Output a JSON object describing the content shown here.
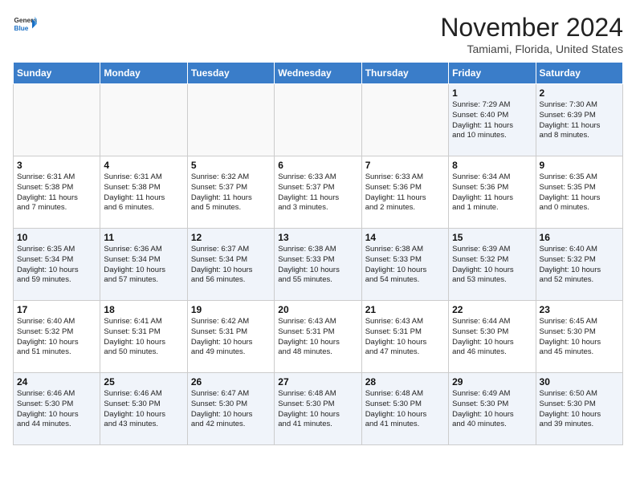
{
  "header": {
    "logo_line1": "General",
    "logo_line2": "Blue",
    "month_title": "November 2024",
    "location": "Tamiami, Florida, United States"
  },
  "weekdays": [
    "Sunday",
    "Monday",
    "Tuesday",
    "Wednesday",
    "Thursday",
    "Friday",
    "Saturday"
  ],
  "weeks": [
    [
      {
        "day": "",
        "detail": ""
      },
      {
        "day": "",
        "detail": ""
      },
      {
        "day": "",
        "detail": ""
      },
      {
        "day": "",
        "detail": ""
      },
      {
        "day": "",
        "detail": ""
      },
      {
        "day": "1",
        "detail": "Sunrise: 7:29 AM\nSunset: 6:40 PM\nDaylight: 11 hours\nand 10 minutes."
      },
      {
        "day": "2",
        "detail": "Sunrise: 7:30 AM\nSunset: 6:39 PM\nDaylight: 11 hours\nand 8 minutes."
      }
    ],
    [
      {
        "day": "3",
        "detail": "Sunrise: 6:31 AM\nSunset: 5:38 PM\nDaylight: 11 hours\nand 7 minutes."
      },
      {
        "day": "4",
        "detail": "Sunrise: 6:31 AM\nSunset: 5:38 PM\nDaylight: 11 hours\nand 6 minutes."
      },
      {
        "day": "5",
        "detail": "Sunrise: 6:32 AM\nSunset: 5:37 PM\nDaylight: 11 hours\nand 5 minutes."
      },
      {
        "day": "6",
        "detail": "Sunrise: 6:33 AM\nSunset: 5:37 PM\nDaylight: 11 hours\nand 3 minutes."
      },
      {
        "day": "7",
        "detail": "Sunrise: 6:33 AM\nSunset: 5:36 PM\nDaylight: 11 hours\nand 2 minutes."
      },
      {
        "day": "8",
        "detail": "Sunrise: 6:34 AM\nSunset: 5:36 PM\nDaylight: 11 hours\nand 1 minute."
      },
      {
        "day": "9",
        "detail": "Sunrise: 6:35 AM\nSunset: 5:35 PM\nDaylight: 11 hours\nand 0 minutes."
      }
    ],
    [
      {
        "day": "10",
        "detail": "Sunrise: 6:35 AM\nSunset: 5:34 PM\nDaylight: 10 hours\nand 59 minutes."
      },
      {
        "day": "11",
        "detail": "Sunrise: 6:36 AM\nSunset: 5:34 PM\nDaylight: 10 hours\nand 57 minutes."
      },
      {
        "day": "12",
        "detail": "Sunrise: 6:37 AM\nSunset: 5:34 PM\nDaylight: 10 hours\nand 56 minutes."
      },
      {
        "day": "13",
        "detail": "Sunrise: 6:38 AM\nSunset: 5:33 PM\nDaylight: 10 hours\nand 55 minutes."
      },
      {
        "day": "14",
        "detail": "Sunrise: 6:38 AM\nSunset: 5:33 PM\nDaylight: 10 hours\nand 54 minutes."
      },
      {
        "day": "15",
        "detail": "Sunrise: 6:39 AM\nSunset: 5:32 PM\nDaylight: 10 hours\nand 53 minutes."
      },
      {
        "day": "16",
        "detail": "Sunrise: 6:40 AM\nSunset: 5:32 PM\nDaylight: 10 hours\nand 52 minutes."
      }
    ],
    [
      {
        "day": "17",
        "detail": "Sunrise: 6:40 AM\nSunset: 5:32 PM\nDaylight: 10 hours\nand 51 minutes."
      },
      {
        "day": "18",
        "detail": "Sunrise: 6:41 AM\nSunset: 5:31 PM\nDaylight: 10 hours\nand 50 minutes."
      },
      {
        "day": "19",
        "detail": "Sunrise: 6:42 AM\nSunset: 5:31 PM\nDaylight: 10 hours\nand 49 minutes."
      },
      {
        "day": "20",
        "detail": "Sunrise: 6:43 AM\nSunset: 5:31 PM\nDaylight: 10 hours\nand 48 minutes."
      },
      {
        "day": "21",
        "detail": "Sunrise: 6:43 AM\nSunset: 5:31 PM\nDaylight: 10 hours\nand 47 minutes."
      },
      {
        "day": "22",
        "detail": "Sunrise: 6:44 AM\nSunset: 5:30 PM\nDaylight: 10 hours\nand 46 minutes."
      },
      {
        "day": "23",
        "detail": "Sunrise: 6:45 AM\nSunset: 5:30 PM\nDaylight: 10 hours\nand 45 minutes."
      }
    ],
    [
      {
        "day": "24",
        "detail": "Sunrise: 6:46 AM\nSunset: 5:30 PM\nDaylight: 10 hours\nand 44 minutes."
      },
      {
        "day": "25",
        "detail": "Sunrise: 6:46 AM\nSunset: 5:30 PM\nDaylight: 10 hours\nand 43 minutes."
      },
      {
        "day": "26",
        "detail": "Sunrise: 6:47 AM\nSunset: 5:30 PM\nDaylight: 10 hours\nand 42 minutes."
      },
      {
        "day": "27",
        "detail": "Sunrise: 6:48 AM\nSunset: 5:30 PM\nDaylight: 10 hours\nand 41 minutes."
      },
      {
        "day": "28",
        "detail": "Sunrise: 6:48 AM\nSunset: 5:30 PM\nDaylight: 10 hours\nand 41 minutes."
      },
      {
        "day": "29",
        "detail": "Sunrise: 6:49 AM\nSunset: 5:30 PM\nDaylight: 10 hours\nand 40 minutes."
      },
      {
        "day": "30",
        "detail": "Sunrise: 6:50 AM\nSunset: 5:30 PM\nDaylight: 10 hours\nand 39 minutes."
      }
    ]
  ]
}
